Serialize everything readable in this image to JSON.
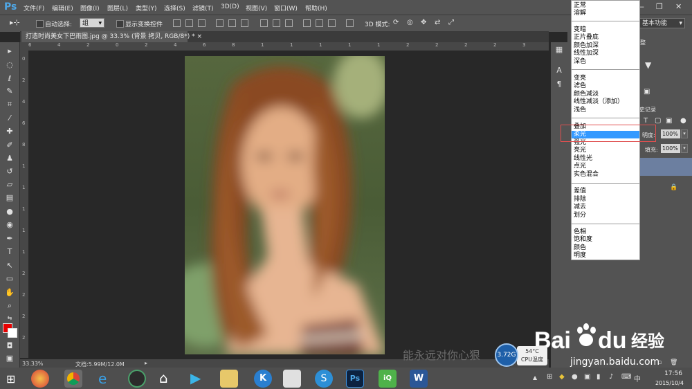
{
  "app": {
    "logo": "Ps"
  },
  "menubar": {
    "items": [
      "文件(F)",
      "编辑(E)",
      "图像(I)",
      "图层(L)",
      "类型(Y)",
      "选择(S)",
      "滤镜(T)",
      "3D(D)",
      "视图(V)",
      "窗口(W)",
      "帮助(H)"
    ]
  },
  "window_controls": {
    "minimize": "—",
    "restore": "❐",
    "close": "✕"
  },
  "options": {
    "auto_select_label": "自动选择:",
    "group_value": "组",
    "show_transform_label": "显示变换控件",
    "mode_3d_label": "3D 模式:",
    "workspace_value": "基本功能"
  },
  "document": {
    "tab_title": "打造时尚美女下巴雨图.jpg @ 33.3% (背景 拷贝, RGB/8*) *",
    "zoom": "33.33%",
    "doc_size": "文档:5.99M/12.0M"
  },
  "ruler_top": [
    "6",
    "4",
    "2",
    "0",
    "2",
    "4",
    "6",
    "8",
    "1",
    "1",
    "1",
    "1",
    "1",
    "2",
    "2",
    "2",
    "2",
    "3"
  ],
  "ruler_left": [
    "0",
    "2",
    "4",
    "6",
    "8",
    "1",
    "1",
    "1",
    "1",
    "1",
    "2",
    "2",
    "2",
    "2"
  ],
  "layers_panel": {
    "opacity_label": "明度:",
    "opacity_value": "100%",
    "fill_label": "填充:",
    "fill_value": "100%",
    "tab_label_1": "整",
    "tab_label_2": "史记录"
  },
  "blend_modes": {
    "groups": [
      [
        "正常",
        "溶解"
      ],
      [
        "变暗",
        "正片叠底",
        "颜色加深",
        "线性加深",
        "深色"
      ],
      [
        "变亮",
        "滤色",
        "颜色减淡",
        "线性减淡（添加）",
        "浅色"
      ],
      [
        "叠加",
        "柔光",
        "强光",
        "亮光",
        "线性光",
        "点光",
        "实色混合"
      ],
      [
        "差值",
        "排除",
        "减去",
        "划分"
      ],
      [
        "色相",
        "饱和度",
        "颜色",
        "明度"
      ]
    ],
    "selected": "柔光"
  },
  "watermark_text": "能永远对你心狠",
  "cpu": {
    "value": "3.72G",
    "temp": "54°C",
    "label": "CPU温度"
  },
  "baidu": {
    "logo_text": "Bai",
    "logo_text2": "du",
    "jingyan": "经验",
    "url": "jingyan.baidu.com"
  },
  "taskbar": {
    "time": "17:56",
    "date": "2015/10/4"
  },
  "colors": {
    "accent_blue": "#3399ff",
    "foreground": "#e50000",
    "background": "#ffffff",
    "ps_blue": "#4fa7e6"
  }
}
